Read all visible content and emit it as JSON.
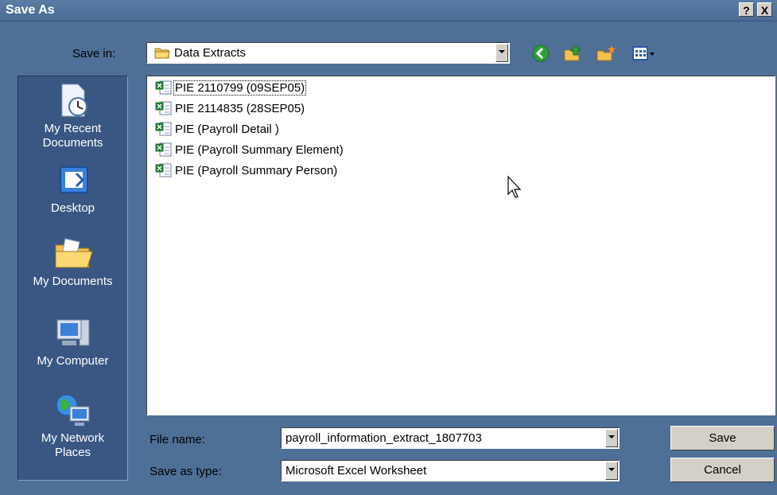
{
  "window": {
    "title": "Save As",
    "help_button": "?",
    "close_button": "X"
  },
  "save_in": {
    "label": "Save in:",
    "value": "Data Extracts"
  },
  "toolbar": {
    "icons": [
      "back-icon",
      "up-folder-icon",
      "new-folder-icon",
      "view-menu-icon"
    ]
  },
  "places": [
    {
      "label_line1": "My Recent",
      "label_line2": "Documents",
      "icon": "recent-documents-icon"
    },
    {
      "label_line1": "Desktop",
      "label_line2": "",
      "icon": "desktop-icon"
    },
    {
      "label_line1": "My Documents",
      "label_line2": "",
      "icon": "my-documents-icon"
    },
    {
      "label_line1": "My Computer",
      "label_line2": "",
      "icon": "my-computer-icon"
    },
    {
      "label_line1": "My Network",
      "label_line2": "Places",
      "icon": "network-places-icon"
    }
  ],
  "files": [
    {
      "name": "PIE 2110799 (09SEP05)",
      "selected": true
    },
    {
      "name": "PIE 2114835 (28SEP05)",
      "selected": false
    },
    {
      "name": "PIE (Payroll Detail )",
      "selected": false
    },
    {
      "name": "PIE (Payroll Summary Element)",
      "selected": false
    },
    {
      "name": "PIE (Payroll Summary Person)",
      "selected": false
    }
  ],
  "file_name": {
    "label": "File name:",
    "value": "payroll_information_extract_1807703"
  },
  "save_as_type": {
    "label": "Save as type:",
    "value": "Microsoft Excel Worksheet"
  },
  "buttons": {
    "save": "Save",
    "cancel": "Cancel"
  },
  "colors": {
    "dialog_background": "#4e6f96",
    "places_bar": "#395782",
    "button_face": "#d4d0c8"
  }
}
